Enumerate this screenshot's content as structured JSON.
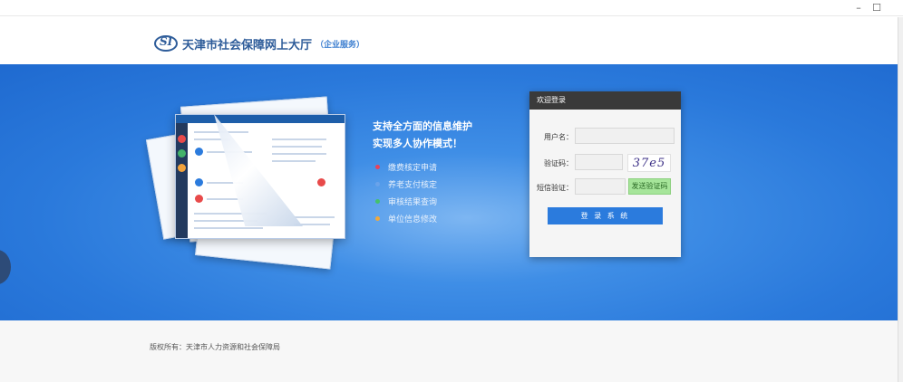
{
  "window": {
    "minimize_glyph": "–",
    "maximize_glyph": "☐"
  },
  "header": {
    "logo_mark": "SI",
    "title": "天津市社会保障网上大厅",
    "subtitle": "（企业服务）"
  },
  "features": {
    "headline_1": "支持全方面的信息维护",
    "headline_2": "实现多人协作模式！",
    "items": [
      {
        "label": "缴费核定申请",
        "color": "#e8435b"
      },
      {
        "label": "养老支付核定",
        "color": "#6aa3ea"
      },
      {
        "label": "审核结果查询",
        "color": "#45c16b"
      },
      {
        "label": "单位信息修改",
        "color": "#f0a83c"
      }
    ]
  },
  "login": {
    "header": "欢迎登录",
    "username_label": "用户名：",
    "captcha_label": "验证码：",
    "sms_label": "短信验证：",
    "captcha_text": "37e5",
    "sms_button": "发送验证码",
    "submit_button": "登 录 系 统"
  },
  "footer": {
    "copyright": "版权所有：天津市人力资源和社会保障局"
  }
}
